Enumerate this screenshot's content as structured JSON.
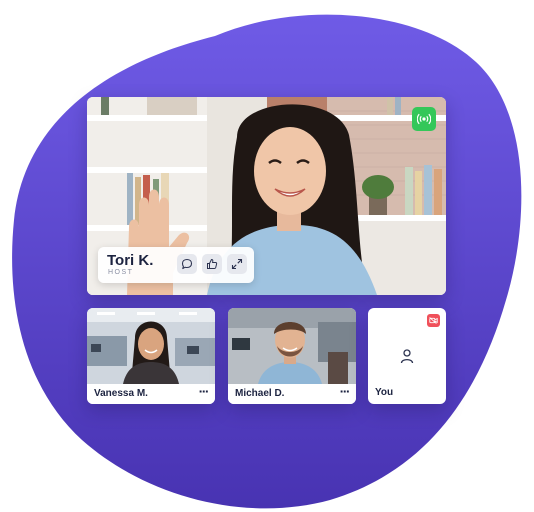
{
  "colors": {
    "blob_top": "#6f5be6",
    "blob_bottom": "#4a36b4",
    "live_green": "#34c759",
    "cam_off_red": "#f0505a",
    "text_dark": "#1c2340",
    "text_muted": "#8a8fa3"
  },
  "host": {
    "name": "Tori K.",
    "role": "HOST",
    "live_icon": "broadcast-icon",
    "actions": [
      {
        "icon": "chat-bubble-icon"
      },
      {
        "icon": "thumbs-up-icon"
      },
      {
        "icon": "expand-icon"
      }
    ]
  },
  "participants": [
    {
      "name": "Vanessa M.",
      "more": "···"
    },
    {
      "name": "Michael D.",
      "more": "···"
    }
  ],
  "self": {
    "name": "You",
    "status_icon": "camera-off-icon",
    "avatar_icon": "user-icon"
  }
}
